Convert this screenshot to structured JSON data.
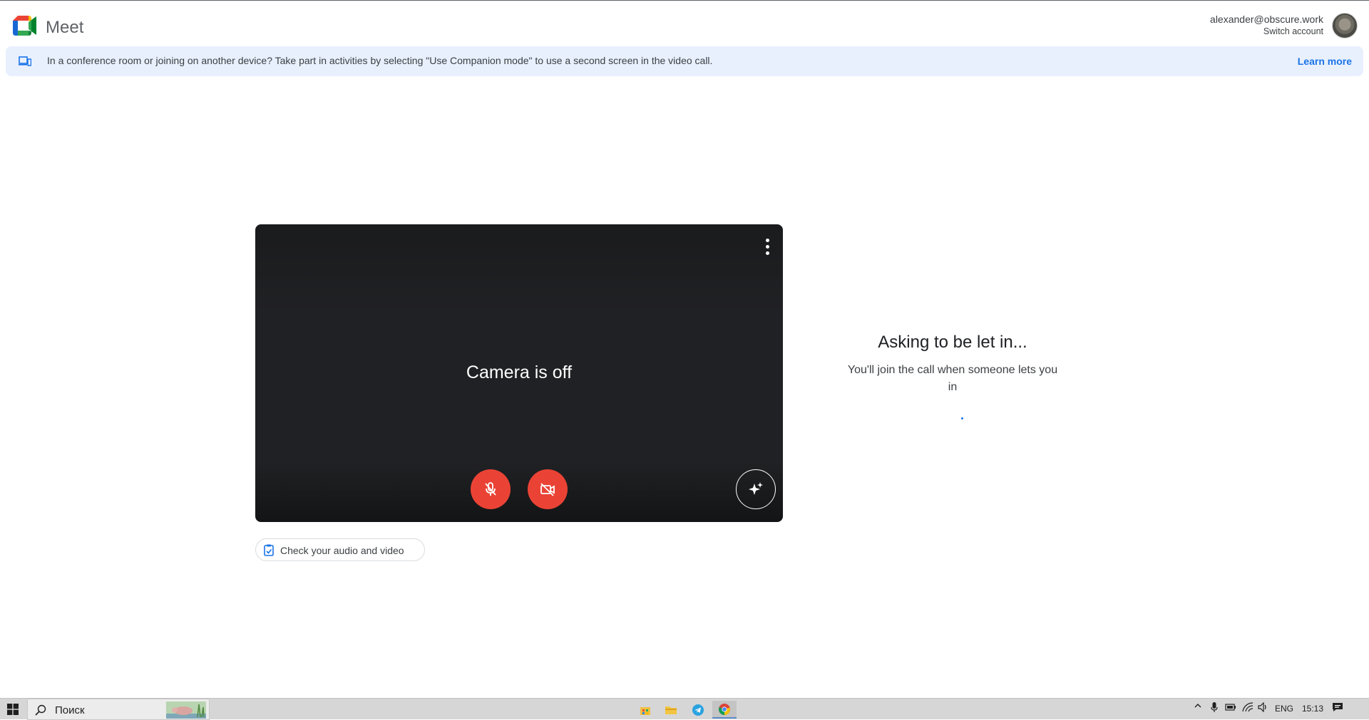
{
  "header": {
    "app_name": "Meet",
    "account_email": "alexander@obscure.work",
    "switch_account": "Switch account"
  },
  "banner": {
    "text": "In a conference room or joining on another device? Take part in activities by selecting \"Use Companion mode\" to use a second screen in the video call.",
    "learn_more": "Learn more"
  },
  "preview": {
    "camera_status": "Camera is off",
    "check_audio_video": "Check your audio and video"
  },
  "side": {
    "title": "Asking to be let in...",
    "subtitle": "You'll join the call when someone lets you in"
  },
  "taskbar": {
    "search_placeholder": "Поиск",
    "language": "ENG",
    "time": "15:13"
  },
  "colors": {
    "accent": "#1a73e8",
    "danger": "#ea4335",
    "banner_bg": "#e8f0fe",
    "preview_bg": "#202124"
  }
}
